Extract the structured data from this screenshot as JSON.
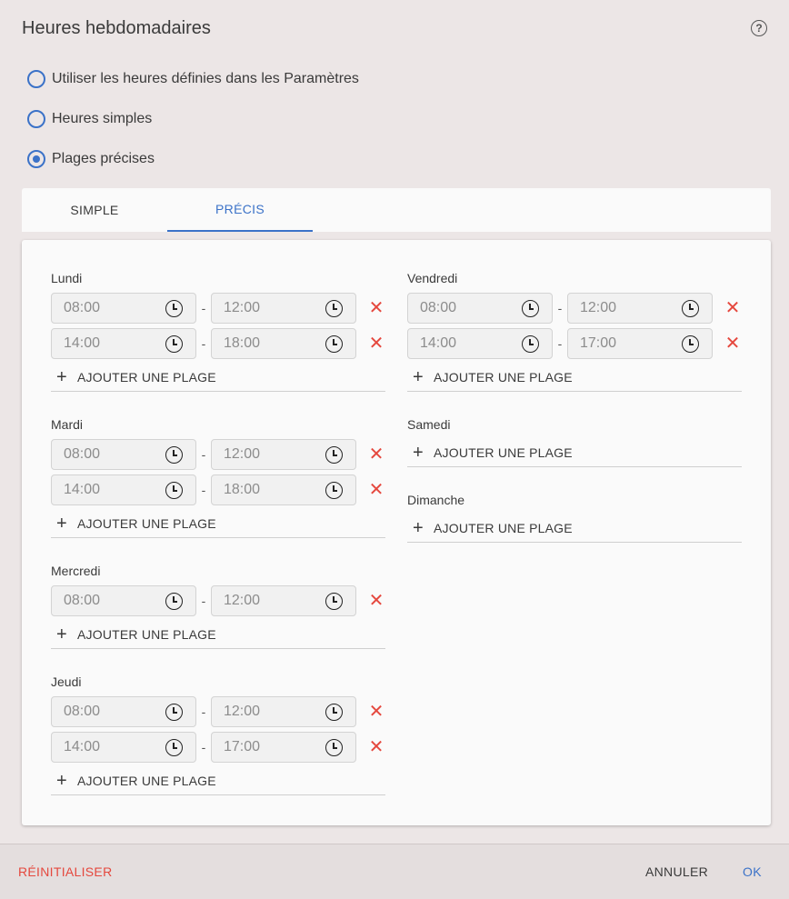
{
  "dialog": {
    "title": "Heures hebdomadaires",
    "help_icon": "help-circle-icon"
  },
  "options": [
    {
      "label": "Utiliser les heures définies dans les Paramètres",
      "checked": false
    },
    {
      "label": "Heures simples",
      "checked": false
    },
    {
      "label": "Plages précises",
      "checked": true
    }
  ],
  "tabs": [
    {
      "label": "SIMPLE",
      "active": false
    },
    {
      "label": "PRÉCIS",
      "active": true
    }
  ],
  "add_label": "AJOUTER UNE PLAGE",
  "separator": "-",
  "days": {
    "lundi": {
      "name": "Lundi",
      "slots": [
        {
          "start": "08:00",
          "end": "12:00"
        },
        {
          "start": "14:00",
          "end": "18:00"
        }
      ]
    },
    "mardi": {
      "name": "Mardi",
      "slots": [
        {
          "start": "08:00",
          "end": "12:00"
        },
        {
          "start": "14:00",
          "end": "18:00"
        }
      ]
    },
    "mercredi": {
      "name": "Mercredi",
      "slots": [
        {
          "start": "08:00",
          "end": "12:00"
        }
      ]
    },
    "jeudi": {
      "name": "Jeudi",
      "slots": [
        {
          "start": "08:00",
          "end": "12:00"
        },
        {
          "start": "14:00",
          "end": "17:00"
        }
      ]
    },
    "vendredi": {
      "name": "Vendredi",
      "slots": [
        {
          "start": "08:00",
          "end": "12:00"
        },
        {
          "start": "14:00",
          "end": "17:00"
        }
      ]
    },
    "samedi": {
      "name": "Samedi",
      "slots": []
    },
    "dimanche": {
      "name": "Dimanche",
      "slots": []
    }
  },
  "footer": {
    "reset_label": "RÉINITIALISER",
    "cancel_label": "ANNULER",
    "ok_label": "OK"
  },
  "colors": {
    "accent": "#3b72c8",
    "danger": "#e5483e",
    "background": "#ece6e6"
  },
  "icons": {
    "radio": "radio-button-icon",
    "clock": "clock-icon",
    "remove": "close-icon",
    "add": "plus-icon"
  }
}
